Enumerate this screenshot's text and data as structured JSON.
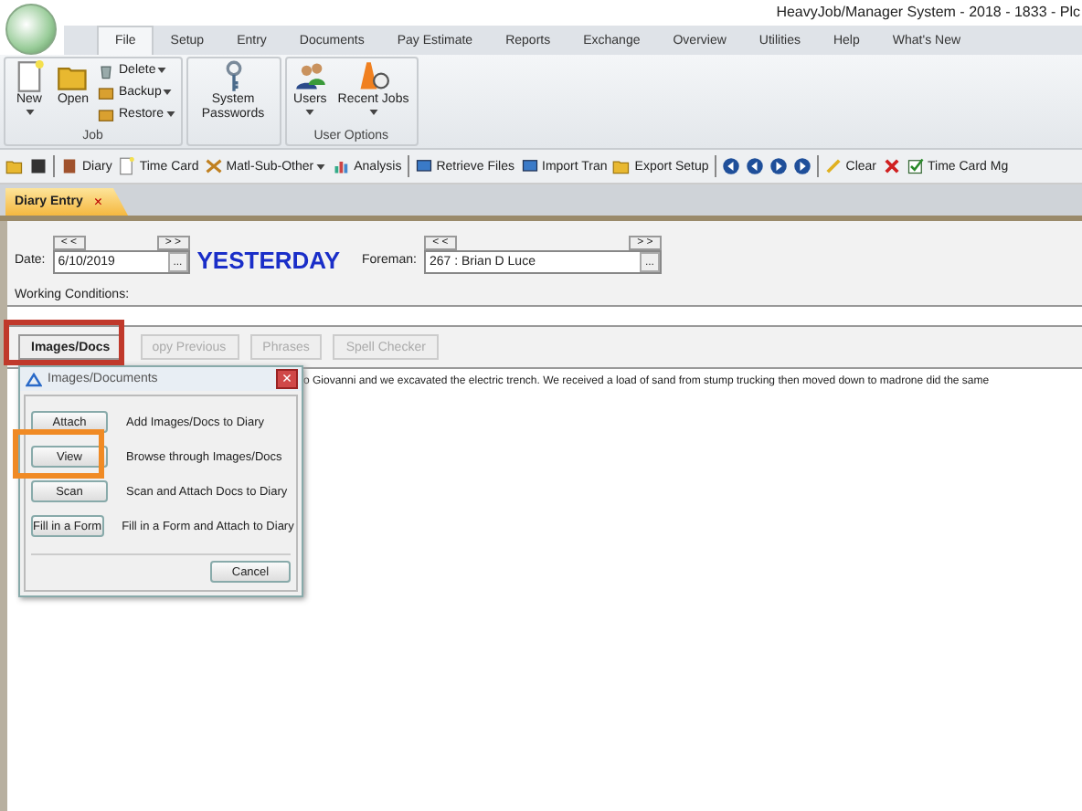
{
  "window": {
    "title": "HeavyJob/Manager System - 2018 - 1833 - Plc"
  },
  "ribbon_tabs": [
    {
      "label": "File",
      "selected": true
    },
    {
      "label": "Setup",
      "selected": false
    },
    {
      "label": "Entry",
      "selected": false
    },
    {
      "label": "Documents",
      "selected": false
    },
    {
      "label": "Pay Estimate",
      "selected": false
    },
    {
      "label": "Reports",
      "selected": false
    },
    {
      "label": "Exchange",
      "selected": false
    },
    {
      "label": "Overview",
      "selected": false
    },
    {
      "label": "Utilities",
      "selected": false
    },
    {
      "label": "Help",
      "selected": false
    },
    {
      "label": "What's New",
      "selected": false
    }
  ],
  "ribbon_groups": [
    {
      "label": "Job",
      "large": [
        {
          "label": "New",
          "dropdown": true
        },
        {
          "label": "Open"
        }
      ],
      "small": [
        {
          "label": "Delete",
          "dropdown": true
        },
        {
          "label": "Backup",
          "dropdown": true
        },
        {
          "label": "Restore",
          "dropdown": true
        }
      ]
    },
    {
      "large": [
        {
          "label": "System Passwords"
        }
      ]
    },
    {
      "label": "User Options",
      "large": [
        {
          "label": "Users",
          "dropdown": true
        },
        {
          "label": "Recent Jobs",
          "dropdown": true
        }
      ]
    }
  ],
  "toolbar": [
    {
      "kind": "icon"
    },
    {
      "kind": "icon"
    },
    {
      "kind": "sep"
    },
    {
      "kind": "item",
      "label": "Diary"
    },
    {
      "kind": "item",
      "label": "Time Card"
    },
    {
      "kind": "item",
      "label": "Matl-Sub-Other",
      "dropdown": true
    },
    {
      "kind": "item",
      "label": "Analysis"
    },
    {
      "kind": "sep"
    },
    {
      "kind": "item",
      "label": "Retrieve Files"
    },
    {
      "kind": "item",
      "label": "Import Tran"
    },
    {
      "kind": "item",
      "label": "Export Setup"
    },
    {
      "kind": "sep"
    },
    {
      "kind": "icon"
    },
    {
      "kind": "icon"
    },
    {
      "kind": "icon"
    },
    {
      "kind": "icon"
    },
    {
      "kind": "sep"
    },
    {
      "kind": "item",
      "label": "Clear"
    },
    {
      "kind": "icon"
    },
    {
      "kind": "item",
      "label": "Time Card Mg"
    }
  ],
  "doc_tabs": [
    {
      "label": "Diary Entry",
      "close": "×",
      "selected": true
    }
  ],
  "form": {
    "date_label": "Date:",
    "date_prev": "< <",
    "date_next": "> >",
    "date_value": "6/10/2019",
    "browse": "...",
    "day_label": "YESTERDAY",
    "foreman_label": "Foreman:",
    "foreman_prev": "< <",
    "foreman_next": "> >",
    "foreman_value": "267 : Brian D Luce",
    "foreman_browse": "...",
    "conditions_label": "Working Conditions:"
  },
  "action_buttons": [
    {
      "label": "Images/Docs",
      "disabled": false
    },
    {
      "label": "opy Previous",
      "disabled": true
    },
    {
      "label": "Phrases",
      "disabled": true
    },
    {
      "label": "Spell Checker",
      "disabled": true
    }
  ],
  "narrative": "o Giovanni and we excavated the electric trench. We received a load of sand from stump trucking then moved down to madrone did the same",
  "dialog": {
    "title": "Images/Documents",
    "close": "×",
    "rows": [
      {
        "button": "Attach",
        "text": "Add Images/Docs to Diary"
      },
      {
        "button": "View",
        "text": "Browse through Images/Docs"
      },
      {
        "button": "Scan",
        "text": "Scan and Attach Docs to Diary"
      },
      {
        "button": "Fill in a Form",
        "text": "Fill in a Form and Attach to Diary"
      }
    ],
    "cancel": "Cancel"
  },
  "highlights": [
    {
      "color": "#c0392b"
    },
    {
      "color": "#f08a24"
    }
  ]
}
